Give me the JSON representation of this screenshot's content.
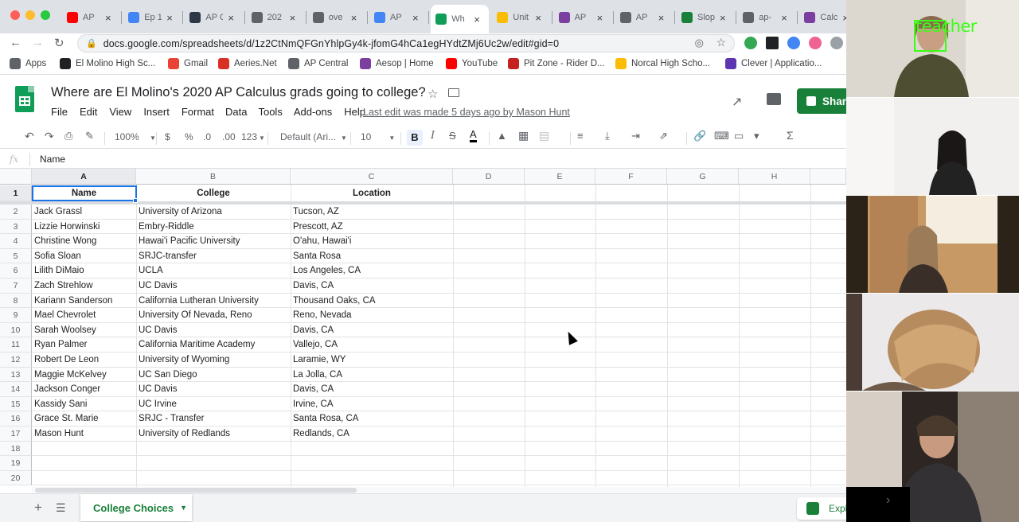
{
  "browser": {
    "tabs": [
      {
        "label": "AP",
        "icon": "youtube-icon",
        "color": "#ff0000"
      },
      {
        "label": "Ep 1",
        "icon": "tab-icon",
        "color": "#4285f4"
      },
      {
        "label": "AP C",
        "icon": "tab-icon",
        "color": "#2d3748"
      },
      {
        "label": "202",
        "icon": "tab-icon",
        "color": "#5f6368"
      },
      {
        "label": "ove",
        "icon": "tab-icon",
        "color": "#5f6368"
      },
      {
        "label": "AP",
        "icon": "docs-icon",
        "color": "#4285f4"
      },
      {
        "label": "Wh",
        "icon": "sheets-icon",
        "color": "#0f9d58"
      },
      {
        "label": "Unit",
        "icon": "drive-icon",
        "color": "#fbbc04"
      },
      {
        "label": "AP",
        "icon": "tab-icon",
        "color": "#7b3fa0"
      },
      {
        "label": "AP",
        "icon": "tab-icon",
        "color": "#5f6368"
      },
      {
        "label": "Slop",
        "icon": "tab-icon",
        "color": "#188038"
      },
      {
        "label": "ap-",
        "icon": "tab-icon",
        "color": "#5f6368"
      },
      {
        "label": "Calc",
        "icon": "tab-icon",
        "color": "#7b3fa0"
      }
    ],
    "url": "docs.google.com/spreadsheets/d/1z2CtNmQFGnYhlpGy4k-jfomG4hCa1egHYdtZMj6Uc2w/edit#gid=0",
    "bookmarks": [
      {
        "label": "Apps",
        "icon": "apps-grid-icon",
        "color": "#5f6368"
      },
      {
        "label": "El Molino High Sc...",
        "icon": "school-icon",
        "color": "#202124"
      },
      {
        "label": "Gmail",
        "icon": "gmail-icon",
        "color": "#ea4335"
      },
      {
        "label": "Aeries.Net",
        "icon": "aeries-icon",
        "color": "#d93025"
      },
      {
        "label": "AP Central",
        "icon": "ap-icon",
        "color": "#5f6368"
      },
      {
        "label": "Aesop | Home",
        "icon": "aesop-icon",
        "color": "#7b3fa0"
      },
      {
        "label": "YouTube",
        "icon": "youtube-icon",
        "color": "#ff0000"
      },
      {
        "label": "Pit Zone - Rider D...",
        "icon": "pitzone-icon",
        "color": "#c5221f"
      },
      {
        "label": "Norcal High Scho...",
        "icon": "norcal-icon",
        "color": "#fbbc04"
      },
      {
        "label": "Clever | Applicatio...",
        "icon": "clever-icon",
        "color": "#5e35b1"
      }
    ]
  },
  "sheet": {
    "title": "Where are El Molino's 2020 AP Calculus grads going to college?",
    "menu": [
      "File",
      "Edit",
      "View",
      "Insert",
      "Format",
      "Data",
      "Tools",
      "Add-ons",
      "Help"
    ],
    "last_edit": "Last edit was made 5 days ago by Mason Hunt",
    "share_label": "Share",
    "toolbar": {
      "zoom": "100%",
      "currency": "$",
      "percent": "%",
      "dec_less": ".0",
      "dec_more": ".00",
      "format_more": "123",
      "font": "Default (Ari...",
      "font_size": "10",
      "bold": "B"
    },
    "formula_bar": {
      "fx": "fx",
      "value": "Name"
    },
    "columns": [
      "A",
      "B",
      "C",
      "D",
      "E",
      "F",
      "G",
      "H"
    ],
    "row_numbers": [
      "1",
      "2",
      "3",
      "4",
      "5",
      "6",
      "7",
      "8",
      "9",
      "10",
      "11",
      "12",
      "13",
      "14",
      "15",
      "16",
      "17",
      "18",
      "19",
      "20"
    ],
    "headers": [
      "Name",
      "College",
      "Location"
    ],
    "rows": [
      [
        "Jack Grassl",
        "University of Arizona",
        "Tucson, AZ"
      ],
      [
        "Lizzie Horwinski",
        "Embry-Riddle",
        "Prescott, AZ"
      ],
      [
        "Christine Wong",
        "Hawai'i Pacific University",
        "O'ahu, Hawai'i"
      ],
      [
        "Sofia Sloan",
        "SRJC-transfer",
        "Santa Rosa"
      ],
      [
        "Lilith DiMaio",
        "UCLA",
        "Los Angeles, CA"
      ],
      [
        "Zach Strehlow",
        "UC Davis",
        "Davis, CA"
      ],
      [
        "Kariann Sanderson",
        "California Lutheran University",
        "Thousand Oaks, CA"
      ],
      [
        "Mael Chevrolet",
        "University Of Nevada, Reno",
        "Reno, Nevada"
      ],
      [
        "Sarah Woolsey",
        "UC Davis",
        "Davis, CA"
      ],
      [
        "Ryan Palmer",
        "California Maritime Academy",
        "Vallejo, CA"
      ],
      [
        "Robert De Leon",
        "University of Wyoming",
        "Laramie, WY"
      ],
      [
        "Maggie McKelvey",
        "UC San Diego",
        "La Jolla, CA"
      ],
      [
        "Jackson Conger",
        "UC Davis",
        "Davis, CA"
      ],
      [
        "Kassidy Sani",
        "UC Irvine",
        "Irvine, CA"
      ],
      [
        "Grace St. Marie",
        "SRJC - Transfer",
        "Santa Rosa, CA"
      ],
      [
        "Mason Hunt",
        "University of Redlands",
        "Redlands, CA"
      ]
    ],
    "sheet_tab": "College Choices",
    "explore_label": "Explore",
    "accent_color": "#188038"
  },
  "video_panel": {
    "teacher_label": "teacher"
  }
}
